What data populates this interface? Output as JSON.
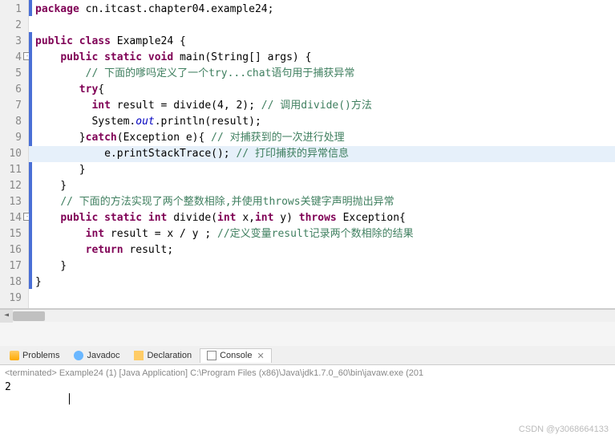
{
  "code": {
    "lines": [
      {
        "n": "1",
        "marker": true
      },
      {
        "n": "2"
      },
      {
        "n": "3",
        "marker": true
      },
      {
        "n": "4",
        "fold": true,
        "marker": true
      },
      {
        "n": "5"
      },
      {
        "n": "6"
      },
      {
        "n": "7"
      },
      {
        "n": "8"
      },
      {
        "n": "9"
      },
      {
        "n": "10",
        "highlighted": true
      },
      {
        "n": "11"
      },
      {
        "n": "12"
      },
      {
        "n": "13"
      },
      {
        "n": "14",
        "fold": true,
        "marker": true
      },
      {
        "n": "15"
      },
      {
        "n": "16"
      },
      {
        "n": "17"
      },
      {
        "n": "18"
      },
      {
        "n": "19"
      }
    ],
    "l1_kw1": "package",
    "l1_pkg": " cn.itcast.chapter04.example24;",
    "l3_kw1": "public",
    "l3_kw2": "class",
    "l3_name": " Example24 {",
    "l4_indent": "    ",
    "l4_kw1": "public",
    "l4_kw2": "static",
    "l4_kw3": "void",
    "l4_name": " main(String[] args) {",
    "l5_indent": "        ",
    "l5_comment": "// 下面的嗲吗定义了一个try...chat语句用于捕获异常",
    "l6_indent": "       ",
    "l6_kw": "try",
    "l6_rest": "{",
    "l7_indent": "         ",
    "l7_kw": "int",
    "l7_rest": " result = divide(4, 2); ",
    "l7_comment": "// 调用divide()方法",
    "l8_indent": "         ",
    "l8_sys": "System.",
    "l8_out": "out",
    "l8_rest": ".println(result);",
    "l9_indent": "       }",
    "l9_kw": "catch",
    "l9_rest": "(Exception e){ ",
    "l9_comment": "// 对捕获到的一次进行处理",
    "l10_indent": "           ",
    "l10_rest": "e.printStackTrace(); ",
    "l10_comment": "// 打印捕获的异常信息",
    "l11_indent": "       }",
    "l12_indent": "    }",
    "l13_indent": "    ",
    "l13_comment": "// 下面的方法实现了两个整数相除,并使用throws关键字声明抛出异常",
    "l14_indent": "    ",
    "l14_kw1": "public",
    "l14_kw2": "static",
    "l14_kw3": "int",
    "l14_name": " divide(",
    "l14_kw4": "int",
    "l14_p1": " x,",
    "l14_kw5": "int",
    "l14_p2": " y) ",
    "l14_kw6": "throws",
    "l14_rest": " Exception{",
    "l15_indent": "        ",
    "l15_kw": "int",
    "l15_rest": " result = x / y ; ",
    "l15_comment": "//定义变量result记录两个数相除的结果",
    "l16_indent": "        ",
    "l16_kw": "return",
    "l16_rest": " result;",
    "l17_indent": "    }",
    "l18_indent": "}"
  },
  "tabs": {
    "problems": "Problems",
    "javadoc": "Javadoc",
    "declaration": "Declaration",
    "console": "Console"
  },
  "console": {
    "header": "<terminated> Example24 (1) [Java Application] C:\\Program Files (x86)\\Java\\jdk1.7.0_60\\bin\\javaw.exe (201",
    "output": "2"
  },
  "watermark": "CSDN @y3068664133"
}
